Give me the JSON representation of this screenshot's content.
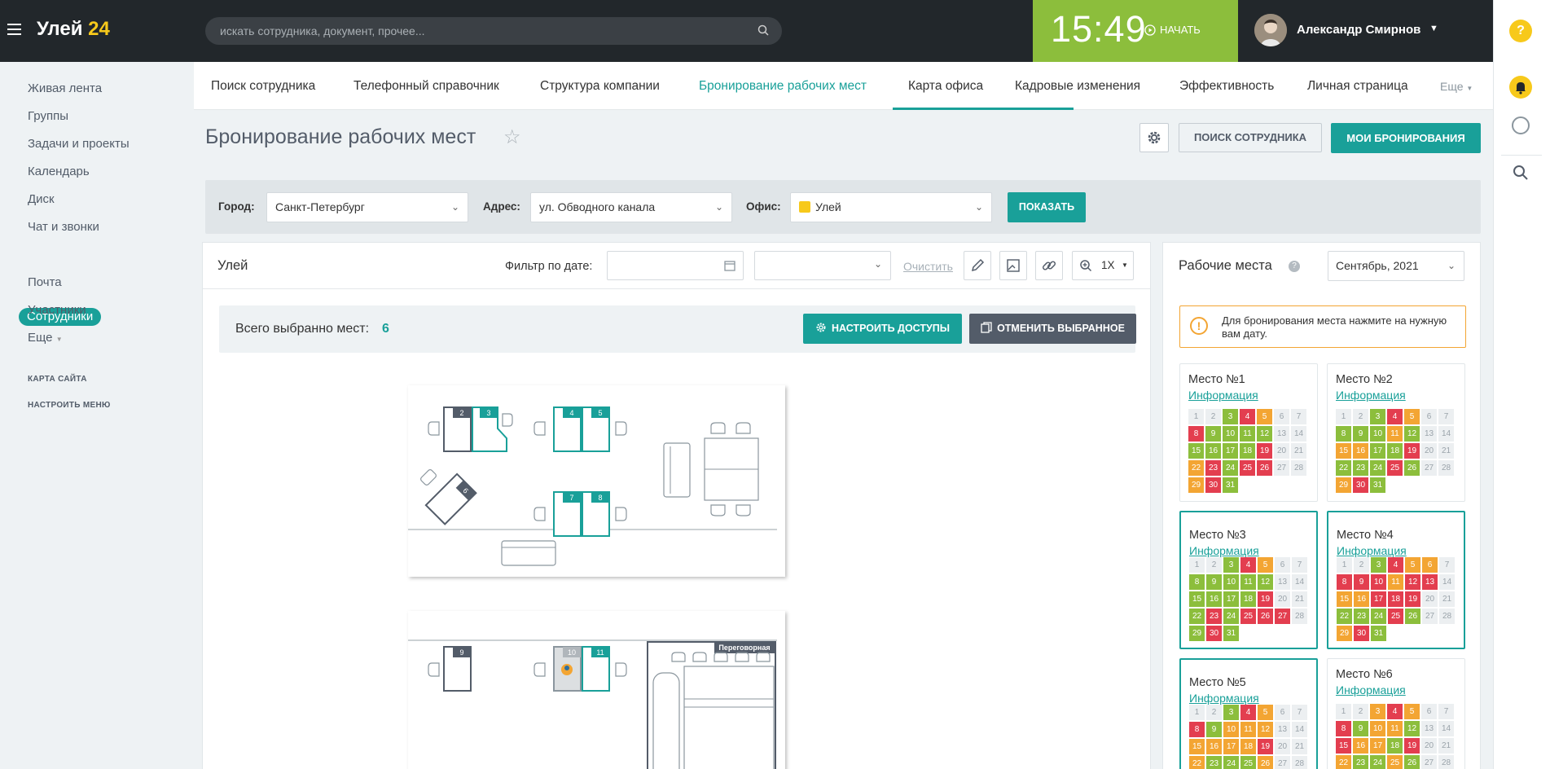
{
  "header": {
    "logo_main": "Улей",
    "logo_num": "24",
    "search_placeholder": "искать сотрудника, документ, прочее...",
    "time": "15:49",
    "start_label": "НАЧАТЬ",
    "user_name": "Александр Смирнов",
    "help_label": "?"
  },
  "left_menu": {
    "items": [
      "Живая лента",
      "Группы",
      "Задачи и проекты",
      "Календарь",
      "Диск",
      "Чат и звонки",
      "Сотрудники",
      "Почта",
      "Участники",
      "Еще"
    ],
    "active": "Сотрудники",
    "sitemap": "КАРТА САЙТА",
    "configure": "НАСТРОИТЬ МЕНЮ"
  },
  "tabs": {
    "items": [
      "Поиск сотрудника",
      "Телефонный справочник",
      "Структура компании",
      "Бронирование рабочих мест",
      "Карта офиса",
      "Кадровые изменения",
      "Эффективность",
      "Личная страница",
      "Еще"
    ],
    "active": "Бронирование рабочих мест"
  },
  "page": {
    "title": "Бронирование рабочих мест",
    "search_btn": "ПОИСК СОТРУДНИКА",
    "my_btn": "МОИ БРОНИРОВАНИЯ"
  },
  "filter": {
    "city_label": "Город:",
    "city": "Санкт-Петербург",
    "address_label": "Адрес:",
    "address": "ул. Обводного канала",
    "office_label": "Офис:",
    "office": "Улей",
    "show_btn": "ПОКАЗАТЬ"
  },
  "map_panel": {
    "name": "Улей",
    "date_filter_label": "Фильтр по дате:",
    "clear_label": "Очистить",
    "zoom": "1X",
    "selected_label": "Всего выбранно мест:",
    "selected_count": "6",
    "access_btn": "НАСТРОИТЬ ДОСТУПЫ",
    "cancel_btn": "ОТМЕНИТЬ ВЫБРАННОЕ",
    "desk_numbers": [
      "2",
      "3",
      "4",
      "5",
      "6",
      "7",
      "8",
      "9",
      "10",
      "11"
    ],
    "room_label": "Переговорная"
  },
  "workplaces": {
    "title": "Рабочие места",
    "help": "?",
    "month": "Сентябрь, 2021",
    "hint": "Для бронирования места нажмите на нужную вам дату.",
    "info_label": "Информация",
    "cards": [
      {
        "title": "Место №1",
        "selected": false,
        "days": [
          "n",
          "n",
          "g",
          "r",
          "o",
          "n",
          "n",
          "r",
          "g",
          "g",
          "g",
          "g",
          "n",
          "n",
          "g",
          "g",
          "g",
          "g",
          "r",
          "n",
          "n",
          "o",
          "r",
          "g",
          "r",
          "r",
          "n",
          "n",
          "o",
          "r",
          "g"
        ]
      },
      {
        "title": "Место №2",
        "selected": false,
        "days": [
          "n",
          "n",
          "g",
          "r",
          "o",
          "n",
          "n",
          "g",
          "g",
          "g",
          "o",
          "g",
          "n",
          "n",
          "o",
          "o",
          "g",
          "g",
          "r",
          "n",
          "n",
          "g",
          "g",
          "g",
          "r",
          "g",
          "n",
          "n",
          "o",
          "r",
          "g"
        ]
      },
      {
        "title": "Место №3",
        "selected": true,
        "days": [
          "n",
          "n",
          "g",
          "r",
          "o",
          "n",
          "n",
          "g",
          "g",
          "g",
          "g",
          "g",
          "n",
          "n",
          "g",
          "g",
          "g",
          "g",
          "r",
          "n",
          "n",
          "g",
          "r",
          "g",
          "r",
          "r",
          "r",
          "n",
          "g",
          "r",
          "g"
        ]
      },
      {
        "title": "Место №4",
        "selected": true,
        "days": [
          "n",
          "n",
          "g",
          "r",
          "o",
          "o",
          "n",
          "r",
          "r",
          "r",
          "o",
          "r",
          "r",
          "n",
          "o",
          "o",
          "r",
          "r",
          "r",
          "n",
          "n",
          "g",
          "g",
          "g",
          "r",
          "g",
          "n",
          "n",
          "o",
          "r",
          "g"
        ]
      },
      {
        "title": "Место №5",
        "selected": true,
        "days": [
          "n",
          "n",
          "g",
          "r",
          "o",
          "n",
          "n",
          "r",
          "g",
          "o",
          "o",
          "o",
          "n",
          "n",
          "o",
          "o",
          "o",
          "o",
          "r",
          "n",
          "n",
          "o",
          "g",
          "g",
          "g",
          "o",
          "n",
          "n",
          "o",
          "r",
          "g"
        ]
      },
      {
        "title": "Место №6",
        "selected": false,
        "days": [
          "n",
          "n",
          "o",
          "r",
          "o",
          "n",
          "n",
          "r",
          "g",
          "o",
          "o",
          "g",
          "n",
          "n",
          "r",
          "o",
          "o",
          "g",
          "r",
          "n",
          "n",
          "o",
          "g",
          "g",
          "o",
          "g",
          "n",
          "n",
          "o",
          "r",
          "g"
        ]
      }
    ]
  },
  "colors": {
    "accent": "#19a099",
    "free": "#8cbe3c",
    "busy": "#e33e4f",
    "partial": "#f3a533",
    "topbar": "#22272b"
  }
}
